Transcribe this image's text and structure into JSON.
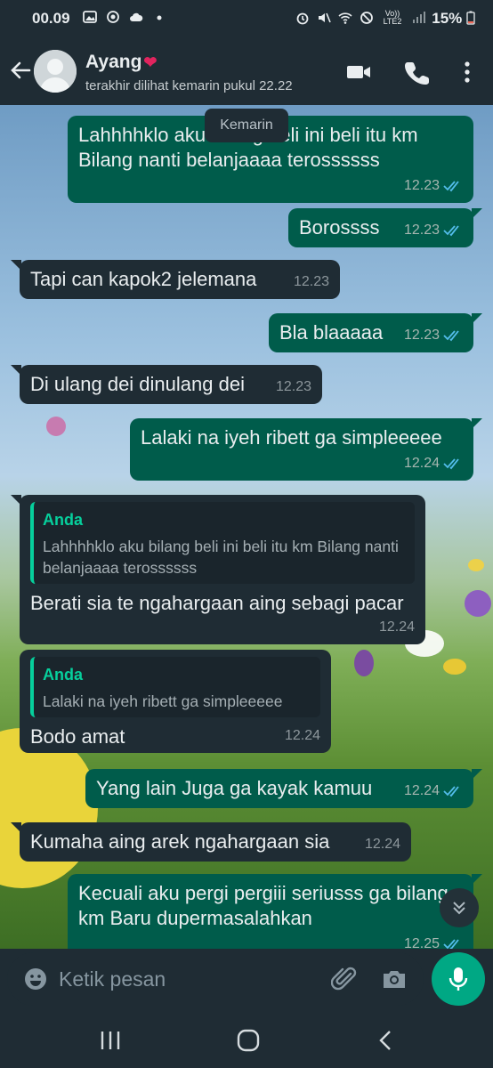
{
  "status_bar": {
    "time": "00.09",
    "network_label": "Vo)) LTE2",
    "battery": "15%"
  },
  "header": {
    "contact_name": "Ayang",
    "contact_emoji": "❤",
    "last_seen": "terakhir dilihat kemarin pukul 22.22",
    "icons": [
      "back-arrow-icon",
      "avatar",
      "video-call-icon",
      "phone-icon",
      "more-vert-icon"
    ]
  },
  "chat": {
    "date_chip": "Kemarin",
    "messages": [
      {
        "dir": "out",
        "text": "Lahhhhklo aku bilang beli ini beli itu km Bilang nanti belanjaaaa terossssss",
        "time": "12.23",
        "read": true
      },
      {
        "dir": "out",
        "text": "Borossss",
        "time": "12.23",
        "read": true
      },
      {
        "dir": "in",
        "text": "Tapi can kapok2 jelemana",
        "time": "12.23"
      },
      {
        "dir": "out",
        "text": "Bla blaaaaa",
        "time": "12.23",
        "read": true
      },
      {
        "dir": "in",
        "text": "Di ulang dei dinulang dei",
        "time": "12.23"
      },
      {
        "dir": "out",
        "text": "Lalaki na iyeh ribett ga simpleeeee",
        "time": "12.24",
        "read": true
      },
      {
        "dir": "in",
        "quote_author": "Anda",
        "quote_text": "Lahhhhklo aku bilang beli ini beli itu km Bilang nanti belanjaaaa terossssss",
        "text": "Berati sia te ngahargaan aing sebagi pacar",
        "time": "12.24"
      },
      {
        "dir": "in",
        "quote_author": "Anda",
        "quote_text": "Lalaki na iyeh ribett ga simpleeeee",
        "text": "Bodo amat",
        "time": "12.24"
      },
      {
        "dir": "out",
        "text": "Yang lain Juga ga kayak kamuu",
        "time": "12.24",
        "read": true
      },
      {
        "dir": "in",
        "text": "Kumaha aing arek ngahargaan sia",
        "time": "12.24"
      },
      {
        "dir": "out",
        "text": "Kecuali aku pergi pergiii seriusss ga bilang km Baru dupermasalahkan",
        "time": "12.25",
        "read": true
      }
    ]
  },
  "input": {
    "placeholder": "Ketik pesan",
    "icons": [
      "emoji-icon",
      "paperclip-icon",
      "camera-icon",
      "mic-icon"
    ]
  },
  "colors": {
    "outgoing_bubble": "#005c4b",
    "incoming_bubble": "#1f2c34",
    "accent": "#00a884",
    "read_tick": "#53bdeb",
    "quote_author": "#06cf9c"
  }
}
